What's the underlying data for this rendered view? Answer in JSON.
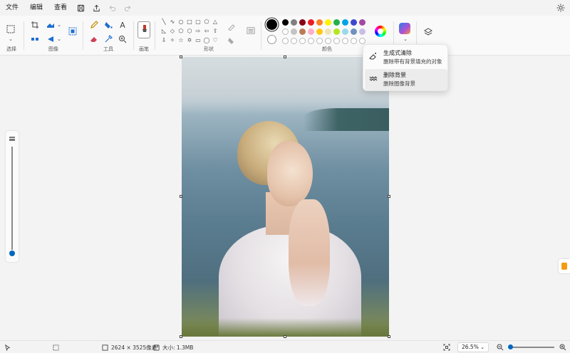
{
  "menu": {
    "file": "文件",
    "edit": "编辑",
    "view": "查看"
  },
  "ribbon": {
    "groups": {
      "select": "选择",
      "image": "图像",
      "tools": "工具",
      "brushes": "画笔",
      "shapes": "形状",
      "colors": "颜色"
    }
  },
  "colors": {
    "primary": "#000000",
    "palette_row1": [
      "#000000",
      "#7f7f7f",
      "#880015",
      "#ed1c24",
      "#ff7f27",
      "#fff200",
      "#22b14c",
      "#00a2e8",
      "#3f48cc",
      "#a349a4"
    ],
    "palette_row2": [
      "#ffffff",
      "#c3c3c3",
      "#b97a57",
      "#ffaec9",
      "#ffc90e",
      "#efe4b0",
      "#b5e61d",
      "#99d9ea",
      "#7092be",
      "#c8bfe7"
    ]
  },
  "popup": {
    "items": [
      {
        "title": "生成式清除",
        "desc": "删除带有背景填充的对象"
      },
      {
        "title": "删除背景",
        "desc": "删除图像背景"
      }
    ]
  },
  "status": {
    "dimensions": "2624 × 3525像素",
    "size": "大小: 1.3MB",
    "zoom": "26.5%"
  }
}
